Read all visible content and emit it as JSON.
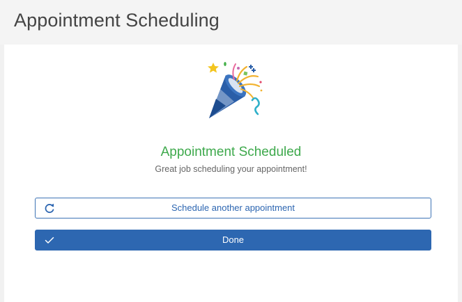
{
  "header": {
    "title": "Appointment Scheduling"
  },
  "confirmation": {
    "illustration_icon": "party-popper-icon",
    "title": "Appointment Scheduled",
    "subtitle": "Great job scheduling your appointment!",
    "title_color": "#3ea94c"
  },
  "actions": {
    "schedule_another": {
      "label": "Schedule another appointment",
      "icon": "refresh-icon"
    },
    "done": {
      "label": "Done",
      "icon": "checkmark-icon"
    }
  },
  "colors": {
    "accent": "#2d67b1",
    "success": "#3ea94c",
    "background": "#f1f1f1"
  }
}
